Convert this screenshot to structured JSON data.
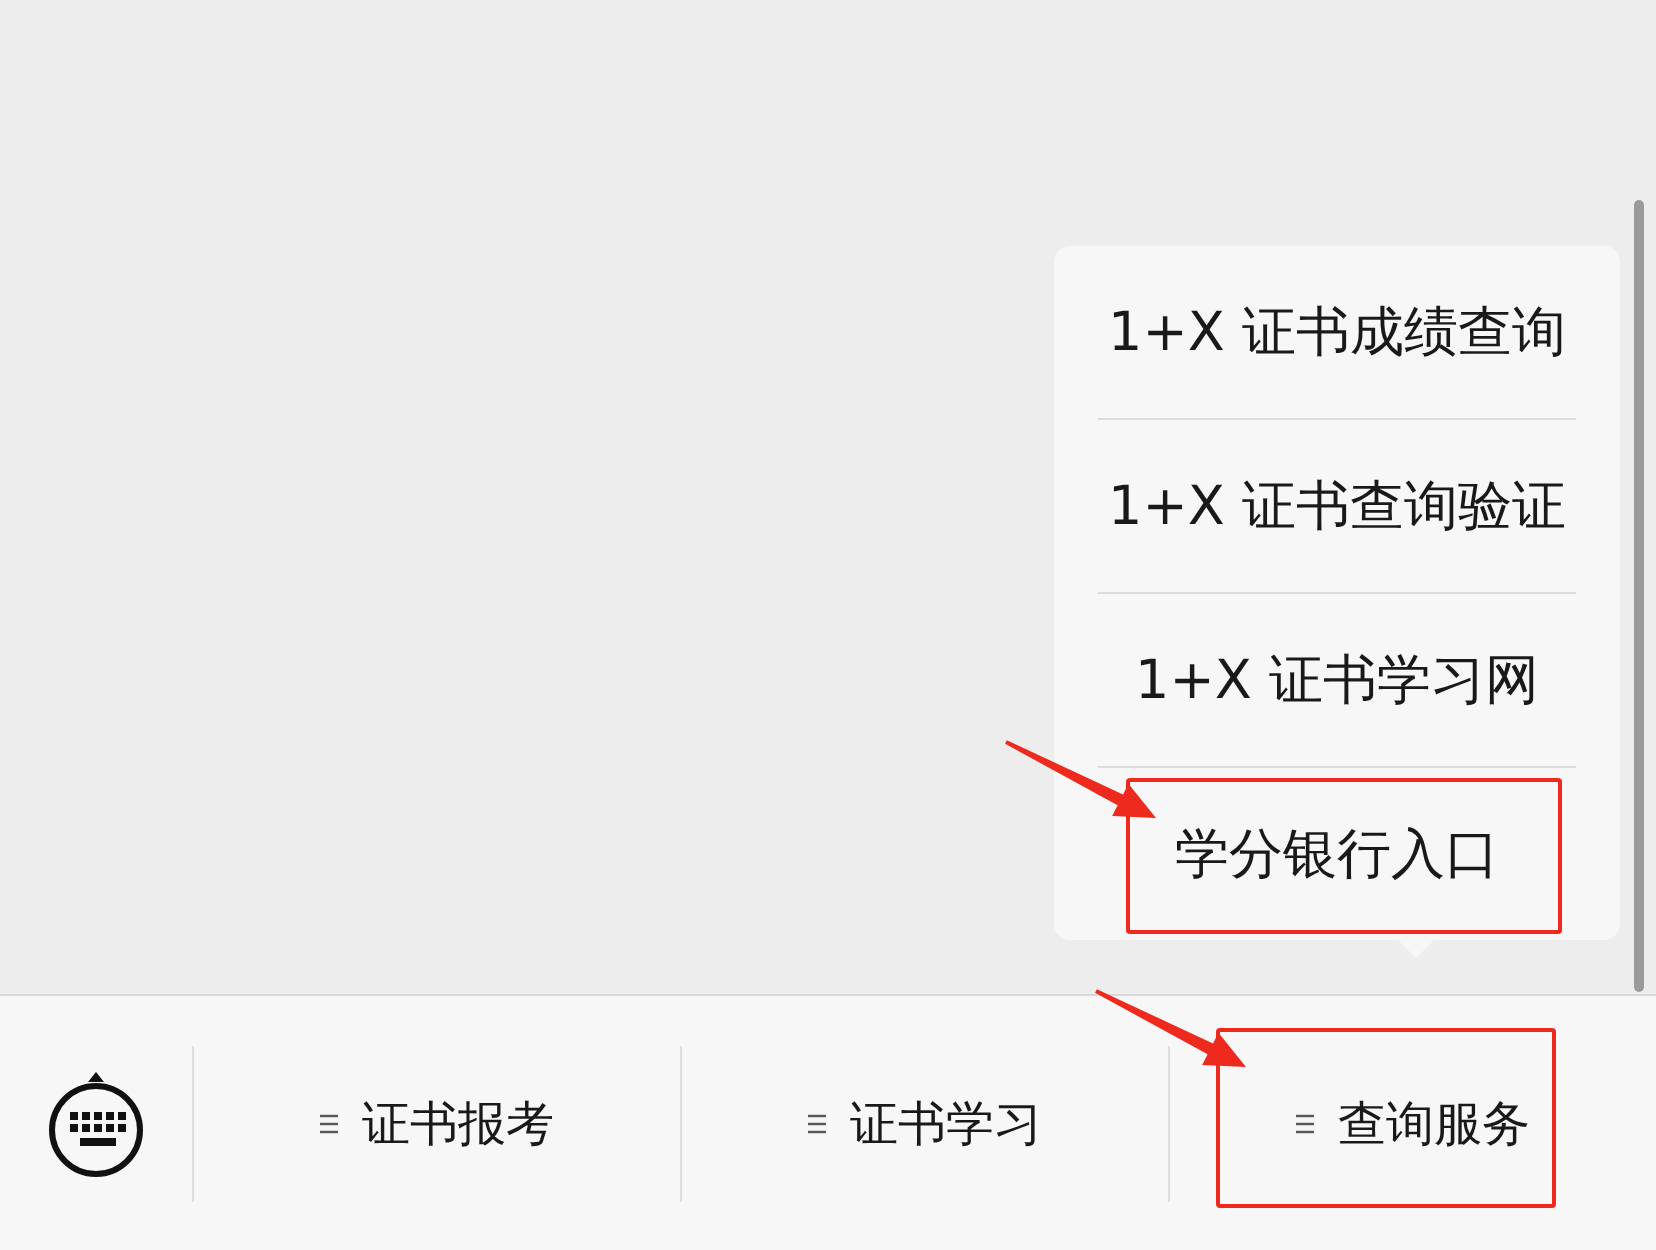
{
  "popup_menu": {
    "items": [
      {
        "label": "1+X 证书成绩查询",
        "highlighted": false
      },
      {
        "label": "1+X 证书查询验证",
        "highlighted": false
      },
      {
        "label": "1+X 证书学习网",
        "highlighted": false
      },
      {
        "label": "学分银行入口",
        "highlighted": true
      }
    ]
  },
  "bottom_menu": {
    "tabs": [
      {
        "label": "证书报考",
        "highlighted": false
      },
      {
        "label": "证书学习",
        "highlighted": false
      },
      {
        "label": "查询服务",
        "highlighted": true
      }
    ]
  }
}
